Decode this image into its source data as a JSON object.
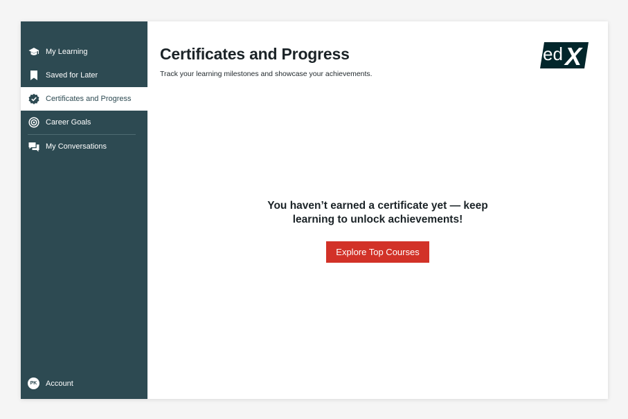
{
  "sidebar": {
    "items": [
      {
        "label": "My Learning",
        "icon": "graduation-cap-icon"
      },
      {
        "label": "Saved for Later",
        "icon": "bookmark-icon"
      },
      {
        "label": "Certificates and Progress",
        "icon": "verified-badge-icon",
        "active": true
      },
      {
        "label": "Career Goals",
        "icon": "target-icon"
      },
      {
        "label": "My Conversations",
        "icon": "chat-bubbles-icon"
      }
    ],
    "account": {
      "initials": "PK",
      "label": "Account"
    }
  },
  "header": {
    "title": "Certificates and Progress",
    "subtitle": "Track your learning milestones and showcase your achievements.",
    "logo": {
      "text": "edX",
      "prefix": "ed",
      "suffix": "X"
    }
  },
  "empty_state": {
    "message": "You haven’t earned a certificate yet — keep learning to unlock achievements!",
    "cta_label": "Explore Top Courses"
  },
  "colors": {
    "sidebar_bg": "#2d4a52",
    "accent_red": "#d23228",
    "text_dark": "#1b2327",
    "logo_bg": "#02262b"
  }
}
